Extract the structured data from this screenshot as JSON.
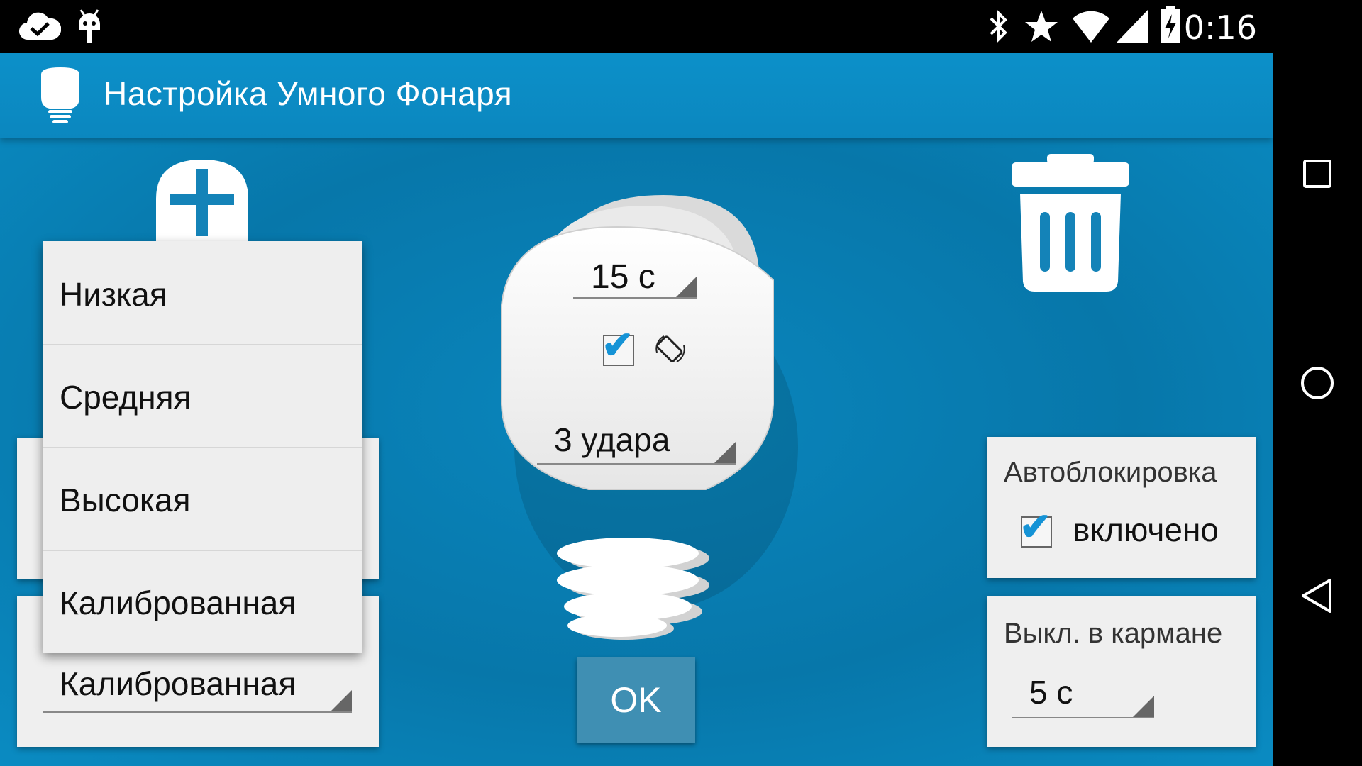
{
  "status_bar": {
    "time": "0:16",
    "icons": [
      "cloud-check-icon",
      "android-debug-icon",
      "bluetooth-icon",
      "star-icon",
      "wifi-icon",
      "signal-icon",
      "battery-charging-icon"
    ]
  },
  "action_bar": {
    "title": "Настройка Умного Фонаря",
    "logo": "bulb-logo-icon"
  },
  "toolbar": {
    "add_icon": "plus-icon",
    "delete_icon": "trash-icon"
  },
  "bulb": {
    "duration_value": "15 с",
    "rotate_checked": true,
    "rotate_icon": "screen-rotation-icon",
    "knocks_value": "3 удара"
  },
  "left_panel": {
    "sensitivity_value": "Калиброванная"
  },
  "dropdown": {
    "options": [
      "Низкая",
      "Средняя",
      "Высокая",
      "Калиброванная"
    ]
  },
  "autolock": {
    "title": "Автоблокировка",
    "checked": true,
    "check_label": "включено"
  },
  "pocket": {
    "title": "Выкл. в кармане",
    "value": "5 с"
  },
  "ok_label": "OK",
  "colors": {
    "accent": "#0b87bf",
    "check_blue": "#1593d6",
    "button": "#3f8fb3"
  }
}
